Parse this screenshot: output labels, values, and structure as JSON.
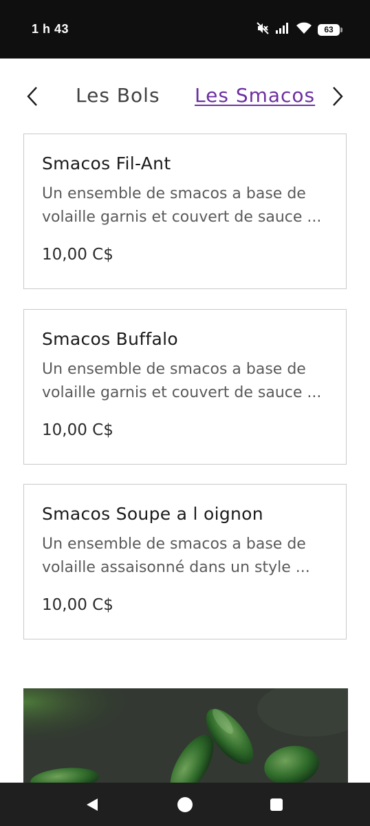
{
  "status_bar": {
    "time": "1 h 43",
    "battery_level": "63",
    "icons": [
      "mute-icon",
      "signal-icon",
      "wifi-icon",
      "battery-icon"
    ]
  },
  "tabs": {
    "items": [
      {
        "label": "Les Bols",
        "active": false
      },
      {
        "label": "Les Smacos",
        "active": true
      }
    ],
    "prev_icon": "chevron-left-icon",
    "next_icon": "chevron-right-icon",
    "active_color": "#6b2fa0"
  },
  "menu_items": [
    {
      "title": "Smacos Fil-Ant",
      "description_line1": "Un ensemble de smacos a base de",
      "description_line2": "volaille garnis et couvert de sauce ...",
      "price": "10,00 C$"
    },
    {
      "title": "Smacos Buffalo",
      "description_line1": "Un ensemble de smacos a base de",
      "description_line2": "volaille garnis et couvert de sauce ...",
      "price": "10,00 C$"
    },
    {
      "title": "Smacos Soupe a l oignon",
      "description_line1": "Un ensemble de smacos a base de",
      "description_line2": "volaille assaisonné dans un style ...",
      "price": "10,00 C$"
    }
  ],
  "nav_bar": {
    "icons": [
      "back-icon",
      "home-icon",
      "recents-icon"
    ]
  }
}
